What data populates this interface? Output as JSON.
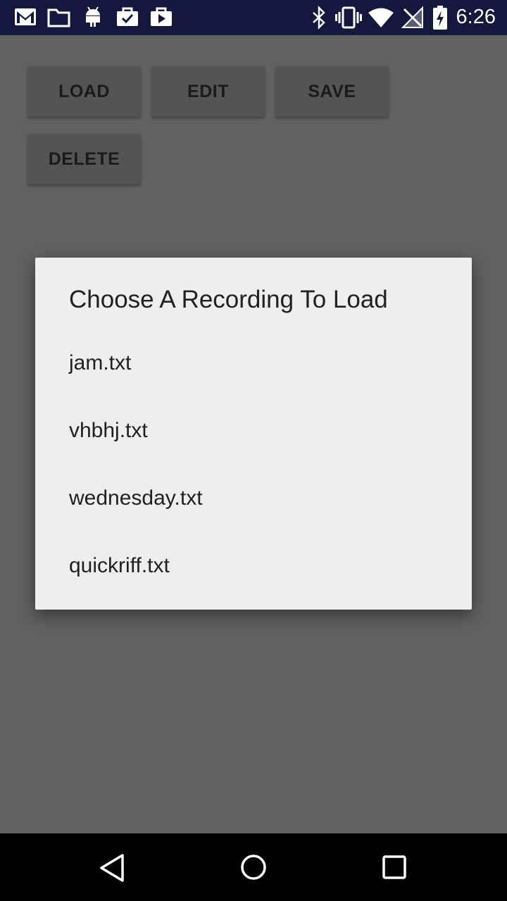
{
  "status_bar": {
    "time": "6:26",
    "left_icons": [
      "gmail-icon",
      "folder-icon",
      "android-icon",
      "briefcase-check-icon",
      "play-store-icon"
    ],
    "right_icons": [
      "bluetooth-icon",
      "vibrate-icon",
      "wifi-icon",
      "no-signal-icon",
      "battery-charging-icon"
    ]
  },
  "toolbar": {
    "load_label": "LOAD",
    "edit_label": "EDIT",
    "save_label": "SAVE",
    "delete_label": "DELETE"
  },
  "dialog": {
    "title": "Choose A Recording To Load",
    "items": [
      {
        "label": "jam.txt"
      },
      {
        "label": "vhbhj.txt"
      },
      {
        "label": "wednesday.txt"
      },
      {
        "label": "quickriff.txt"
      }
    ]
  },
  "nav_bar": {
    "buttons": [
      "back-icon",
      "home-icon",
      "recents-icon"
    ]
  },
  "colors": {
    "status_bar_bg": "#15173e",
    "app_bg_dimmed": "#616161",
    "button_bg": "#545454",
    "dialog_bg": "#eeeeee",
    "nav_bar_bg": "#000000"
  }
}
